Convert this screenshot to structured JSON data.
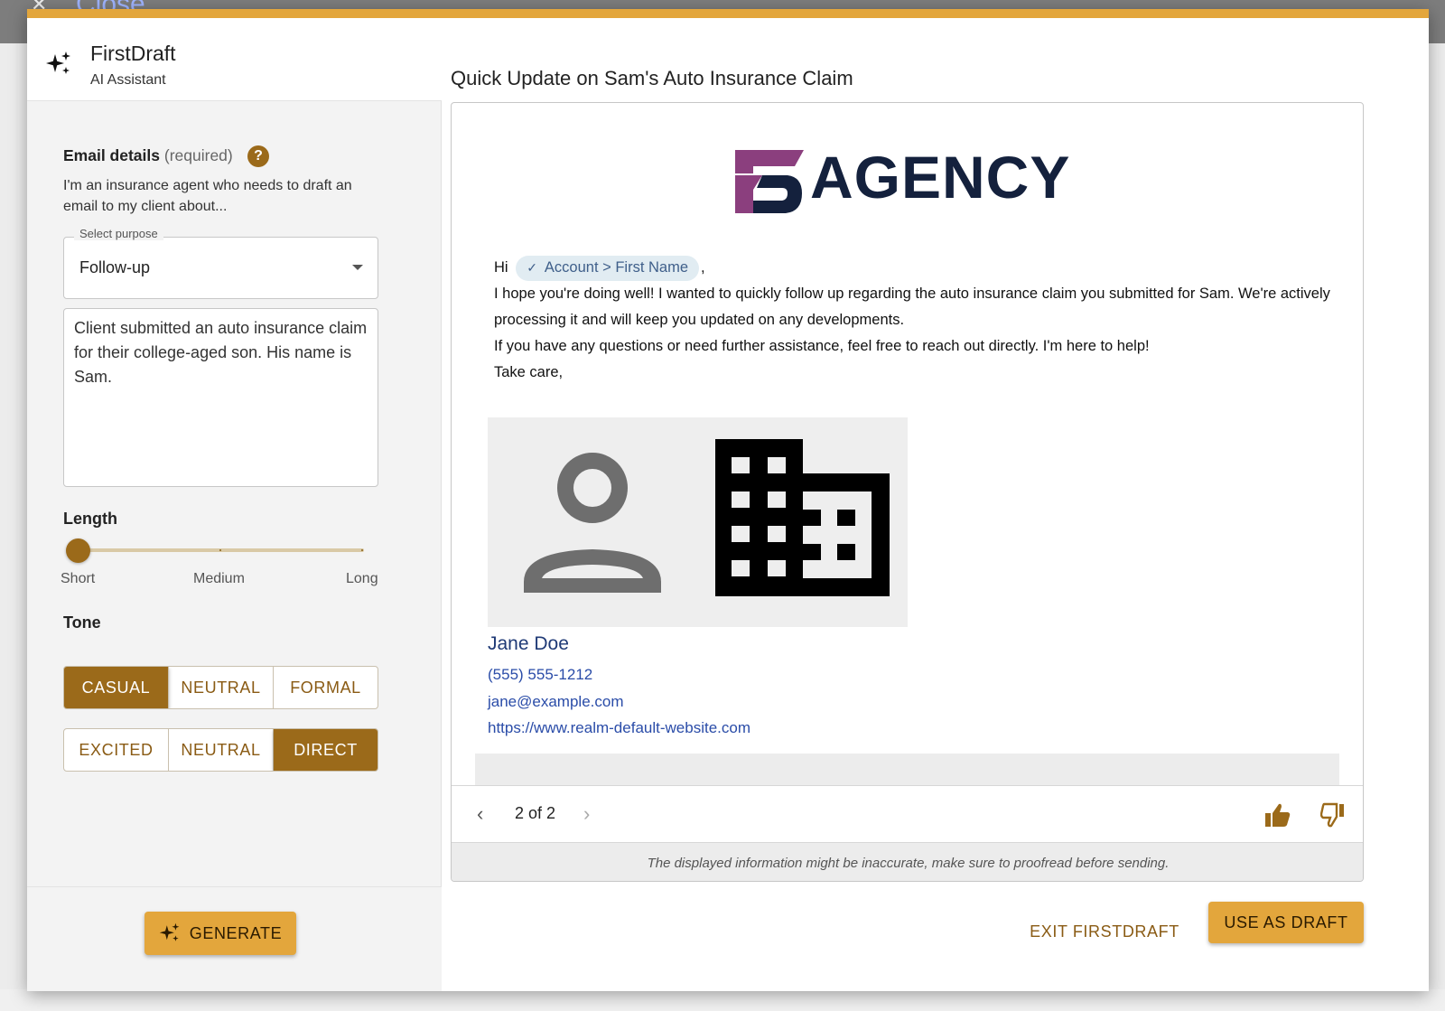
{
  "backdrop": {
    "close_label": "Close"
  },
  "colors": {
    "accent": "#e3a63c",
    "accent_dark": "#9b6a1a",
    "brand_navy": "#14213d",
    "chip_bg": "#e1ecf2",
    "link": "#2a4ca8"
  },
  "app": {
    "title": "FirstDraft",
    "subtitle": "AI Assistant",
    "icon": "sparkles-icon"
  },
  "email_details": {
    "label": "Email details",
    "required_note": "(required)",
    "help_icon": "?",
    "description": "I'm an insurance agent who needs to draft an email to my client about...",
    "purpose_legend": "Select purpose",
    "purpose_value": "Follow-up",
    "notes": "Client submitted an auto insurance claim for their college-aged son. His name is Sam."
  },
  "length": {
    "label": "Length",
    "marks": [
      "Short",
      "Medium",
      "Long"
    ],
    "selected": "Short"
  },
  "tone": {
    "label": "Tone",
    "row1": [
      "CASUAL",
      "NEUTRAL",
      "FORMAL"
    ],
    "row1_selected": "CASUAL",
    "row2": [
      "EXCITED",
      "NEUTRAL",
      "DIRECT"
    ],
    "row2_selected": "DIRECT"
  },
  "generate_label": "GENERATE",
  "preview": {
    "subject": "Quick Update on Sam's Auto Insurance Claim",
    "logo_text": "AGENCY",
    "greeting": "Hi",
    "chip_label": "Account > First Name",
    "greeting_suffix": ",",
    "lines": [
      "I hope you're doing well! I wanted to quickly follow up regarding the auto insurance claim you submitted for Sam. We're actively processing it and will keep you updated on any developments.",
      "If you have any questions or need further assistance, feel free to reach out directly. I'm here to help!",
      "Take care,"
    ],
    "signature": {
      "name": "Jane Doe",
      "phone": "(555) 555-1212",
      "email": "jane@example.com",
      "website": "https://www.realm-default-website.com"
    },
    "pager": "2 of 2",
    "disclaimer": "The displayed information might be inaccurate, make sure to proofread before sending."
  },
  "actions": {
    "exit": "EXIT FIRSTDRAFT",
    "use_draft": "USE AS DRAFT"
  }
}
